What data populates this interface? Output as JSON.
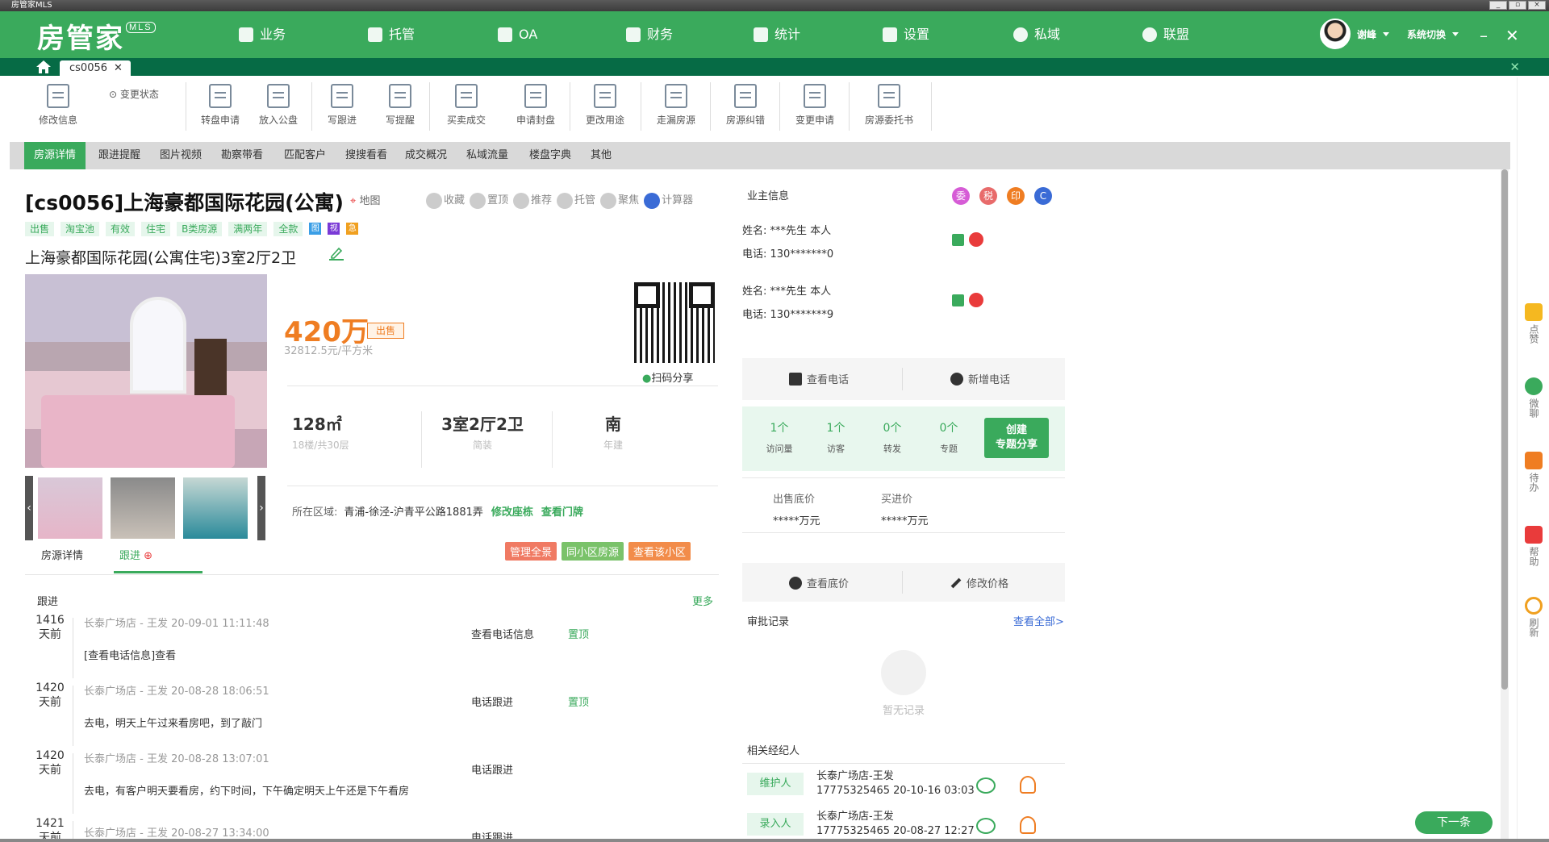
{
  "window": {
    "title": "房管家MLS"
  },
  "brand": {
    "logo": "房管家",
    "badge": "MLS"
  },
  "nav": [
    {
      "label": "业务"
    },
    {
      "label": "托管"
    },
    {
      "label": "OA"
    },
    {
      "label": "财务"
    },
    {
      "label": "统计"
    },
    {
      "label": "设置"
    },
    {
      "label": "私域"
    },
    {
      "label": "联盟"
    }
  ],
  "user": {
    "name": "谢峰",
    "switch": "系统切换"
  },
  "tabs": [
    {
      "label": "cs0056"
    }
  ],
  "toolbar": {
    "edit_info": "修改信息",
    "change_state": "变更状态",
    "items": [
      {
        "label": "转盘申请"
      },
      {
        "label": "放入公盘"
      },
      {
        "label": "写跟进"
      },
      {
        "label": "写提醒"
      },
      {
        "label": "买卖成交"
      },
      {
        "label": "申请封盘"
      },
      {
        "label": "更改用途"
      },
      {
        "label": "走漏房源"
      },
      {
        "label": "房源纠错"
      },
      {
        "label": "变更申请"
      },
      {
        "label": "房源委托书"
      }
    ]
  },
  "subtabs": [
    {
      "label": "房源详情"
    },
    {
      "label": "跟进提醒"
    },
    {
      "label": "图片视频"
    },
    {
      "label": "勘察带看"
    },
    {
      "label": "匹配客户"
    },
    {
      "label": "搜搜看看"
    },
    {
      "label": "成交概况"
    },
    {
      "label": "私域流量"
    },
    {
      "label": "楼盘字典"
    },
    {
      "label": "其他"
    }
  ],
  "listing": {
    "title": "[cs0056]上海豪都国际花园(公寓)",
    "map": "地图",
    "actions": [
      "收藏",
      "置顶",
      "推荐",
      "托管",
      "聚焦",
      "计算器"
    ],
    "tags": [
      "出售",
      "淘宝池",
      "有效",
      "住宅",
      "B类房源",
      "满两年",
      "全款"
    ],
    "tag_icons": [
      "图",
      "视",
      "急"
    ],
    "subtitle": "上海豪都国际花园(公寓住宅)3室2厅2卫",
    "price": "420万",
    "price_badge": "出售",
    "unit_price": "32812.5元/平方米",
    "qr_label": "扫码分享",
    "specs": [
      {
        "value": "128㎡",
        "sub": "18楼/共30层"
      },
      {
        "value": "3室2厅2卫",
        "sub": "简装"
      },
      {
        "value": "南",
        "sub": "年建"
      }
    ],
    "region_label": "所在区域:",
    "region_value": "青浦-徐泾-沪青平公路1881弄",
    "edit_building": "修改座栋",
    "view_door": "查看门牌",
    "buttons": [
      "管理全景",
      "同小区房源",
      "查看该小区"
    ],
    "detail_tabs": [
      "房源详情",
      "跟进"
    ]
  },
  "followups": {
    "header": "跟进",
    "more": "更多",
    "items": [
      {
        "days": "1416",
        "unit": "天前",
        "meta": "长泰广场店 - 王发  20-09-01 11:11:48",
        "type": "查看电话信息",
        "top": "置顶",
        "text": "[查看电话信息]查看"
      },
      {
        "days": "1420",
        "unit": "天前",
        "meta": "长泰广场店 - 王发  20-08-28 18:06:51",
        "type": "电话跟进",
        "top": "置顶",
        "text": "去电，明天上午过来看房吧，到了敲门"
      },
      {
        "days": "1420",
        "unit": "天前",
        "meta": "长泰广场店 - 王发  20-08-28 13:07:01",
        "type": "电话跟进",
        "top": "",
        "text": "去电，有客户明天要看房，约下时间，下午确定明天上午还是下午看房"
      },
      {
        "days": "1421",
        "unit": "天前",
        "meta": "长泰广场店 - 王发  20-08-27 13:34:00",
        "type": "电话跟进",
        "top": "",
        "text": ""
      }
    ]
  },
  "owner": {
    "title": "业主信息",
    "icons": [
      "委",
      "税",
      "印",
      "C"
    ],
    "contacts": [
      {
        "name": "姓名: ***先生  本人",
        "phone": "电话: 130*******0"
      },
      {
        "name": "姓名: ***先生  本人",
        "phone": "电话: 130*******9"
      }
    ],
    "view_phone": "查看电话",
    "add_phone": "新增电话"
  },
  "stats": {
    "items": [
      {
        "num": "1个",
        "label": "访问量"
      },
      {
        "num": "1个",
        "label": "访客"
      },
      {
        "num": "0个",
        "label": "转发"
      },
      {
        "num": "0个",
        "label": "专题"
      }
    ],
    "create_line1": "创建",
    "create_line2": "专题分享"
  },
  "prices": {
    "sell_floor_label": "出售底价",
    "sell_floor_value": "*****万元",
    "buy_label": "买进价",
    "buy_value": "*****万元",
    "view_floor": "查看底价",
    "edit_price": "修改价格"
  },
  "approval": {
    "title": "审批记录",
    "view_all": "查看全部>",
    "empty": "暂无记录"
  },
  "agents": {
    "title": "相关经纪人",
    "items": [
      {
        "role": "维护人",
        "name": "长泰广场店-王发",
        "detail": "17775325465  20-10-16 03:03"
      },
      {
        "role": "录入人",
        "name": "长泰广场店-王发",
        "detail": "17775325465  20-08-27 12:27"
      }
    ]
  },
  "rightbar": [
    {
      "label": "点赞"
    },
    {
      "label": "微聊"
    },
    {
      "label": "待办"
    },
    {
      "label": "帮助"
    },
    {
      "label": "刷新"
    }
  ],
  "next_label": "下一条"
}
